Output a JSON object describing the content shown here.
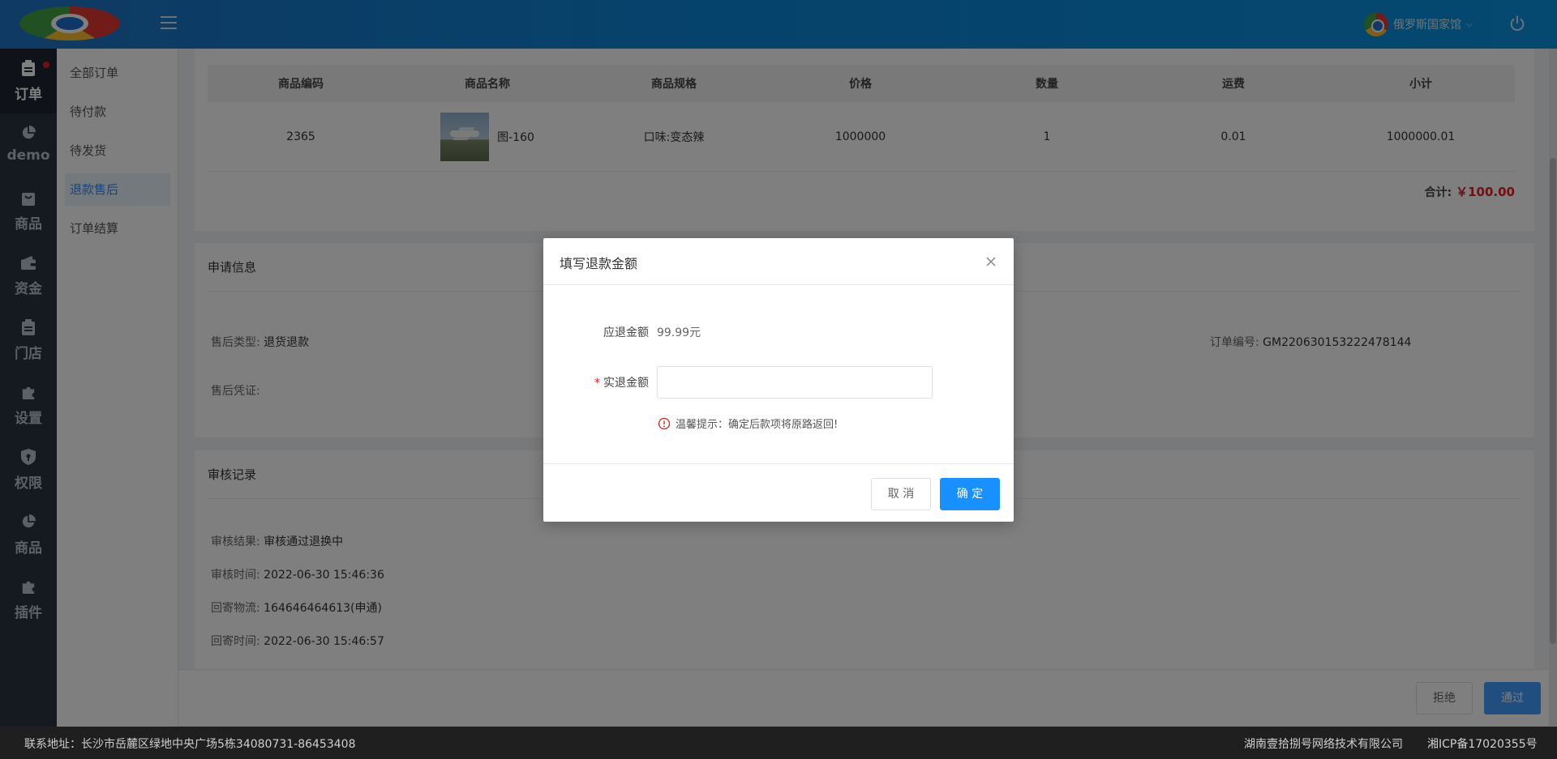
{
  "header": {
    "user_name": "俄罗斯国家馆"
  },
  "nav": {
    "items": [
      {
        "label": "订单",
        "icon": "clipboard-icon"
      },
      {
        "label": "demo",
        "icon": "pie-chart-icon"
      },
      {
        "label": "商品",
        "icon": "bag-icon"
      },
      {
        "label": "资金",
        "icon": "wallet-icon"
      },
      {
        "label": "门店",
        "icon": "clipboard-icon"
      },
      {
        "label": "设置",
        "icon": "puzzle-icon"
      },
      {
        "label": "权限",
        "icon": "shield-icon"
      },
      {
        "label": "商品",
        "icon": "pie-chart-icon"
      },
      {
        "label": "插件",
        "icon": "puzzle-icon"
      }
    ]
  },
  "subnav": {
    "items": [
      {
        "label": "全部订单"
      },
      {
        "label": "待付款"
      },
      {
        "label": "待发货"
      },
      {
        "label": "退款售后"
      },
      {
        "label": "订单结算"
      }
    ]
  },
  "goods_table": {
    "headers": [
      "商品编码",
      "商品名称",
      "商品规格",
      "价格",
      "数量",
      "运费",
      "小计"
    ],
    "row": {
      "code": "2365",
      "name": "图-160",
      "spec": "口味:变态辣",
      "price": "1000000",
      "qty": "1",
      "shipping": "0.01",
      "subtotal": "1000000.01"
    },
    "total_label": "合计:",
    "total_amount": "￥100.00"
  },
  "apply_info": {
    "title": "申请信息",
    "type_label": "售后类型:",
    "type_value": "退货退款",
    "order_no_label": "订单编号:",
    "order_no_value": "GM220630153222478144",
    "proof_label": "售后凭证:"
  },
  "audit": {
    "title": "审核记录",
    "result_label": "审核结果:",
    "result_value": "审核通过退换中",
    "time_label": "审核时间:",
    "time_value": "2022-06-30 15:46:36",
    "logistics_label": "回寄物流:",
    "logistics_value": "164646464613(申通)",
    "send_time_label": "回寄时间:",
    "send_time_value": "2022-06-30 15:46:57"
  },
  "actions": {
    "reject": "拒绝",
    "pass": "通过"
  },
  "footer": {
    "address": "联系地址：长沙市岳麓区绿地中央广场5栋34080731-86453408",
    "company": "湖南壹拾捌号网络技术有限公司",
    "icp": "湘ICP备17020355号"
  },
  "modal": {
    "title": "填写退款金额",
    "due_label": "应退金额",
    "due_value": "99.99元",
    "actual_label": "实退金额",
    "actual_value": "",
    "tip": "温馨提示：确定后款项将原路返回!",
    "cancel": "取 消",
    "confirm": "确 定"
  },
  "colors": {
    "header": "#1e74c6",
    "accent": "#1890ff",
    "danger": "#e02020",
    "sidebar": "#2b3443"
  }
}
